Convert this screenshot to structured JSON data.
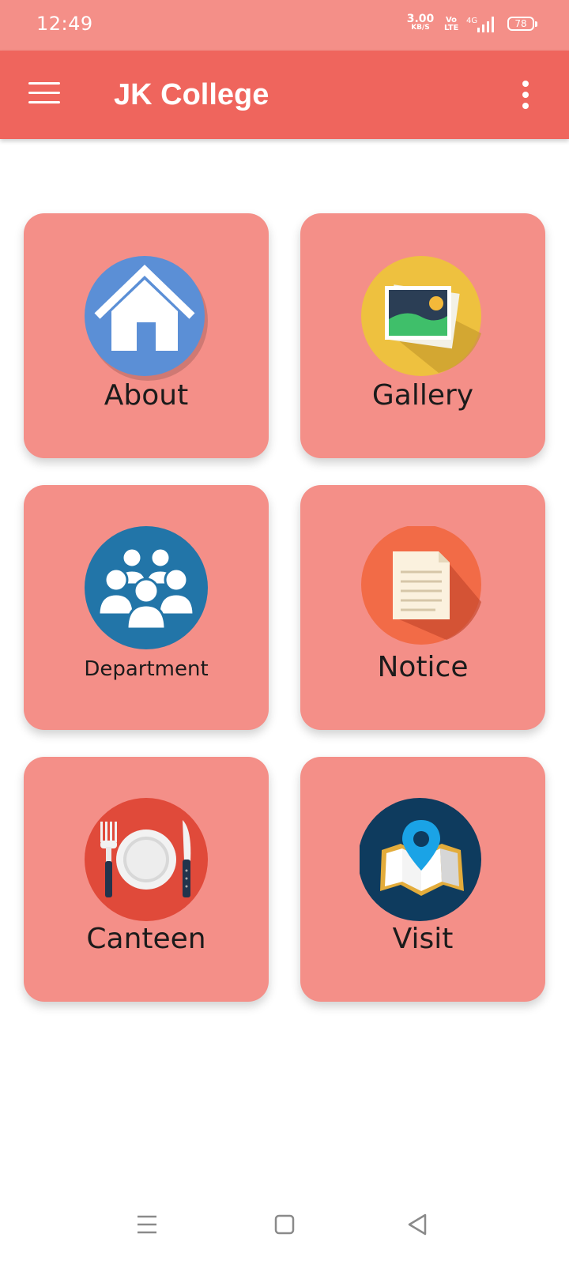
{
  "status_bar": {
    "time": "12:49",
    "net_speed": "3.00",
    "net_unit": "KB/S",
    "volte": "Vo LTE",
    "network": "4G",
    "battery": "78"
  },
  "app_bar": {
    "title": "JK College"
  },
  "tiles": [
    {
      "label": "About",
      "icon": "home-icon"
    },
    {
      "label": "Gallery",
      "icon": "picture-icon"
    },
    {
      "label": "Department",
      "icon": "people-icon"
    },
    {
      "label": "Notice",
      "icon": "document-icon"
    },
    {
      "label": "Canteen",
      "icon": "plate-icon"
    },
    {
      "label": "Visit",
      "icon": "map-pin-icon"
    }
  ],
  "colors": {
    "app_bar": "#ef655d",
    "status_bar": "#f48f88",
    "tile": "#f48f88"
  }
}
